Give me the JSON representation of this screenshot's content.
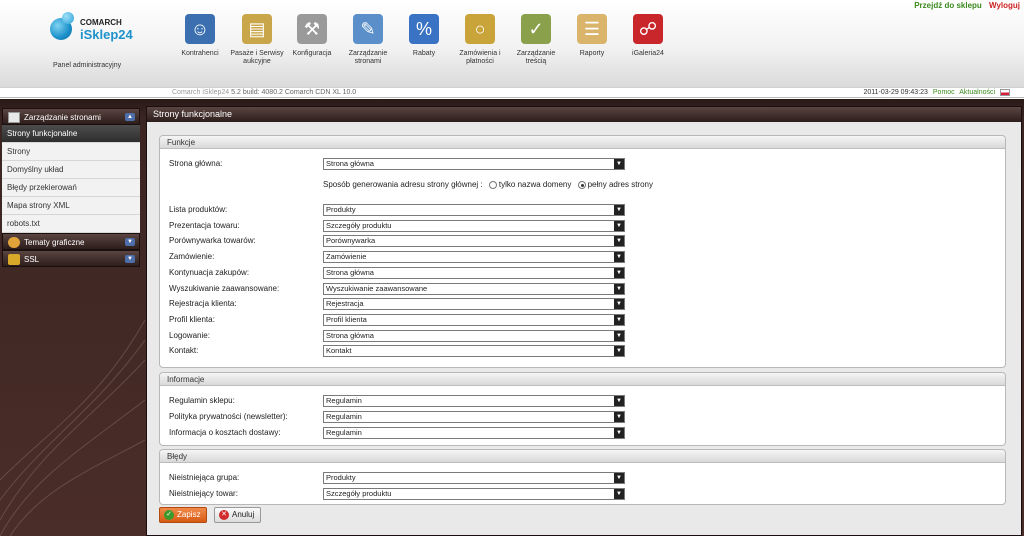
{
  "top_links": {
    "shop": "Przejdź do sklepu",
    "logout": "Wyloguj"
  },
  "logo": {
    "company": "COMARCH",
    "product": "iSklep24"
  },
  "panel_label": "Panel administracyjny",
  "nav": [
    {
      "label": "Kontrahenci",
      "icon": "users-icon",
      "color": "#3b6fb0"
    },
    {
      "label": "Pasaże i Serwisy aukcyjne",
      "icon": "folder-icon",
      "color": "#c9a64a"
    },
    {
      "label": "Konfiguracja",
      "icon": "wrench-icon",
      "color": "#9a9a9a"
    },
    {
      "label": "Zarządzanie stronami",
      "icon": "page-edit-icon",
      "color": "#5a8fc9"
    },
    {
      "label": "Rabaty",
      "icon": "price-tag-icon",
      "color": "#3a72c4"
    },
    {
      "label": "Zamówienia i płatności",
      "icon": "coins-icon",
      "color": "#c8a43a"
    },
    {
      "label": "Zarządzanie treścią",
      "icon": "content-edit-icon",
      "color": "#8aa04a"
    },
    {
      "label": "Raporty",
      "icon": "clipboard-icon",
      "color": "#d9b46a"
    },
    {
      "label": "iGaleria24",
      "icon": "shopping-bag-icon",
      "color": "#c9262c"
    }
  ],
  "version": {
    "app": "Comarch iSklep24",
    "build": "5.2 build: 4080.2",
    "cdn": "Comarch CDN XL 10.0"
  },
  "status": {
    "datetime": "2011-03-29 09:43:23",
    "help": "Pomoc",
    "news": "Aktualności"
  },
  "sidebar": {
    "section_pages": "Zarządzanie stronami",
    "items": [
      "Strony funkcjonalne",
      "Strony",
      "Domyślny układ",
      "Błędy przekierowań",
      "Mapa strony XML",
      "robots.txt"
    ],
    "section_themes": "Tematy graficzne",
    "section_ssl": "SSL"
  },
  "main": {
    "title": "Strony funkcjonalne",
    "funkcje": {
      "heading": "Funkcje",
      "home_label": "Strona główna:",
      "home_value": "Strona główna",
      "url_mode_label": "Sposób generowania adresu strony głównej :",
      "url_option_domain": "tylko nazwa domeny",
      "url_option_full": "pełny adres strony",
      "rows": [
        {
          "label": "Lista produktów:",
          "value": "Produkty"
        },
        {
          "label": "Prezentacja towaru:",
          "value": "Szczegóły produktu"
        },
        {
          "label": "Porównywarka towarów:",
          "value": "Porównywarka"
        },
        {
          "label": "Zamówienie:",
          "value": "Zamówienie"
        },
        {
          "label": "Kontynuacja zakupów:",
          "value": "Strona główna"
        },
        {
          "label": "Wyszukiwanie zaawansowane:",
          "value": "Wyszukiwanie zaawansowane"
        },
        {
          "label": "Rejestracja klienta:",
          "value": "Rejestracja"
        },
        {
          "label": "Profil klienta:",
          "value": "Profil klienta"
        },
        {
          "label": "Logowanie:",
          "value": "Strona główna"
        },
        {
          "label": "Kontakt:",
          "value": "Kontakt"
        }
      ]
    },
    "informacje": {
      "heading": "Informacje",
      "rows": [
        {
          "label": "Regulamin sklepu:",
          "value": "Regulamin"
        },
        {
          "label": "Polityka prywatności (newsletter):",
          "value": "Regulamin"
        },
        {
          "label": "Informacja o kosztach dostawy:",
          "value": "Regulamin"
        }
      ]
    },
    "bledy": {
      "heading": "Błędy",
      "rows": [
        {
          "label": "Nieistniejąca grupa:",
          "value": "Produkty"
        },
        {
          "label": "Nieistniejący towar:",
          "value": "Szczegóły produktu"
        }
      ]
    },
    "buttons": {
      "save": "Zapisz",
      "cancel": "Anuluj"
    }
  }
}
